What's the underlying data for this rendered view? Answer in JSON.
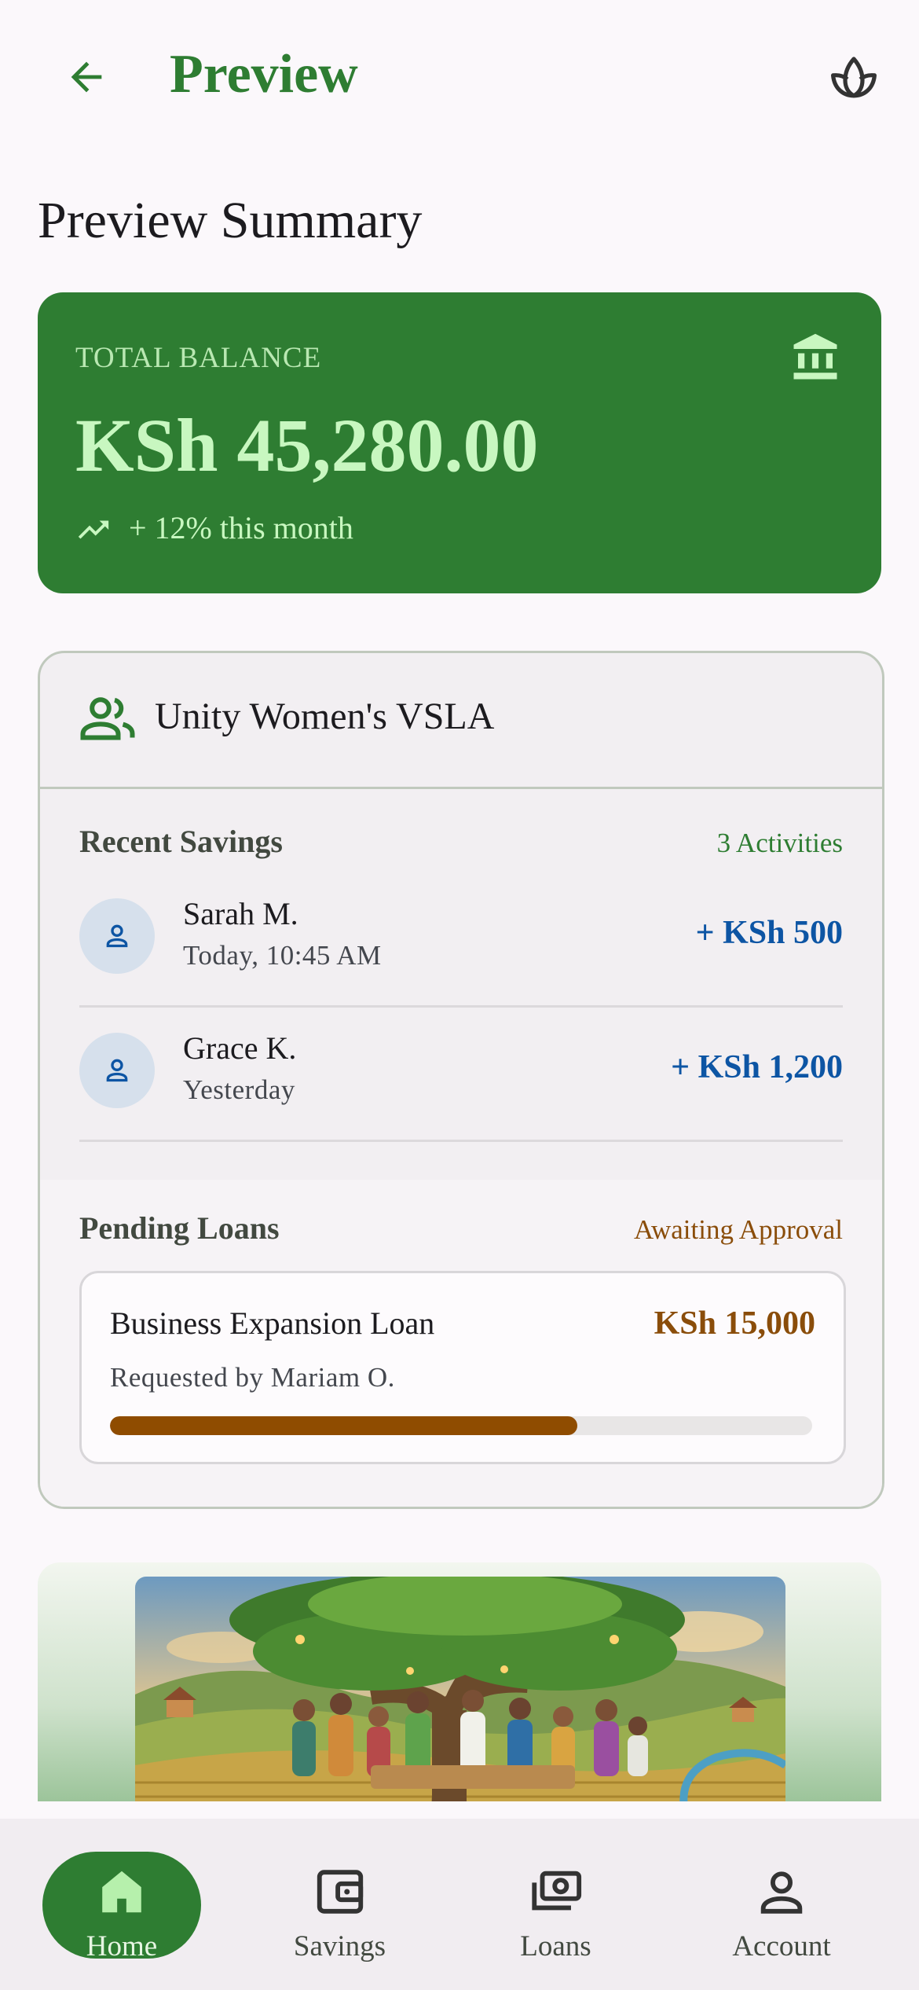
{
  "app_bar": {
    "title": "Preview",
    "back_icon": "arrow-back-icon",
    "action_icon": "leaf-icon"
  },
  "page": {
    "title": "Preview Summary"
  },
  "balance": {
    "label": "TOTAL BALANCE",
    "amount": "KSh 45,280.00",
    "trend": "+ 12% this month",
    "icon": "bank-icon"
  },
  "group": {
    "name": "Unity Women's VSLA",
    "icon": "group-icon",
    "recent_savings": {
      "title": "Recent Savings",
      "meta": "3 Activities",
      "items": [
        {
          "name": "Sarah M.",
          "time": "Today, 10:45 AM",
          "amount": "+ KSh 500"
        },
        {
          "name": "Grace K.",
          "time": "Yesterday",
          "amount": "+ KSh 1,200"
        }
      ]
    },
    "pending_loans": {
      "title": "Pending Loans",
      "meta": "Awaiting Approval",
      "loan": {
        "title": "Business Expansion Loan",
        "amount": "KSh 15,000",
        "requested_by": "Requested by Mariam O.",
        "progress": 0.665
      }
    }
  },
  "nav": {
    "items": [
      {
        "label": "Home",
        "icon": "home-icon",
        "active": true
      },
      {
        "label": "Savings",
        "icon": "wallet-icon",
        "active": false
      },
      {
        "label": "Loans",
        "icon": "cash-icon",
        "active": false
      },
      {
        "label": "Account",
        "icon": "person-icon",
        "active": false
      }
    ]
  },
  "colors": {
    "primary": "#2e7d32",
    "balance_text": "#c8f7c0",
    "savings_amount": "#0d55a4",
    "loan_accent": "#8f4c00",
    "background": "#fbf8fb"
  }
}
